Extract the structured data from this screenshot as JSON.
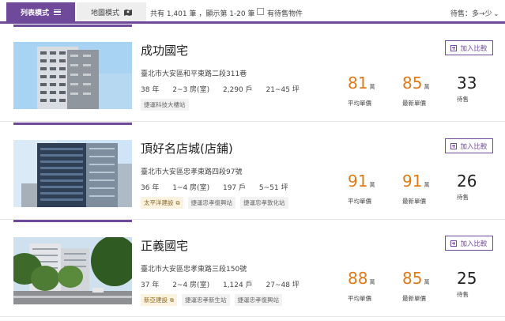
{
  "toolbar": {
    "list_tab": "列表模式",
    "map_tab": "地圖模式",
    "count_prefix": "共有 1,401 筆 ，顯示第 1-20 筆",
    "only_for_sale": "有待售物件",
    "sort": "待售：多→少",
    "accent_color": "#6f4a9a"
  },
  "listings": [
    {
      "name": "成功國宅",
      "address": "臺北市大安區和平東路二段311巷",
      "age": "38 年",
      "layout": "2~3 房(室)",
      "units": "2,290 戶",
      "size": "21~45 坪",
      "tags": [
        "捷運科技大樓站"
      ],
      "builder": "",
      "avg_price": "81",
      "latest_price": "85",
      "for_sale": "33",
      "compare_label": "加入比較"
    },
    {
      "name": "頂好名店城(店鋪)",
      "address": "臺北市大安區忠孝東路四段97號",
      "age": "36 年",
      "layout": "1~4 房(室)",
      "units": "197 戶",
      "size": "5~51 坪",
      "builder": "太平洋建設",
      "tags": [
        "捷運忠孝復興站",
        "捷運忠孝敦化站"
      ],
      "avg_price": "91",
      "latest_price": "91",
      "for_sale": "26",
      "compare_label": "加入比較"
    },
    {
      "name": "正義國宅",
      "address": "臺北市大安區忠孝東路三段150號",
      "age": "37 年",
      "layout": "2~4 房(室)",
      "units": "1,124 戶",
      "size": "27~48 坪",
      "builder": "新亞建設",
      "tags": [
        "捷運忠孝新生站",
        "捷運忠孝復興站"
      ],
      "avg_price": "88",
      "latest_price": "85",
      "for_sale": "25",
      "compare_label": "加入比較"
    }
  ],
  "labels": {
    "unit_wan": "萬",
    "avg_price": "平均單價",
    "latest_price": "最新單價",
    "for_sale": "待售"
  }
}
